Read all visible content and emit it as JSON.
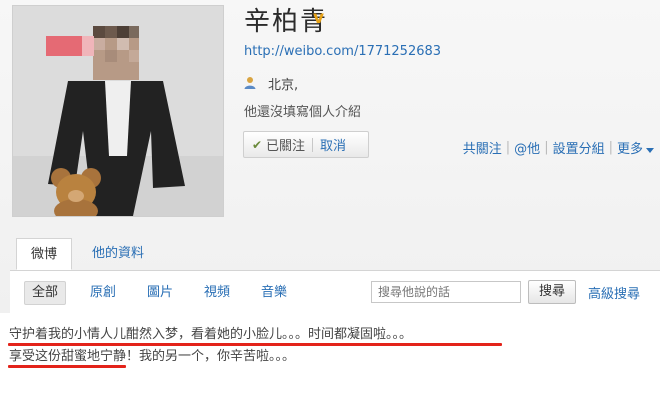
{
  "profile": {
    "name": "辛柏青",
    "verified_badge": "v",
    "url": "http://weibo.com/1771252683",
    "location": "北京,",
    "intro": "他還沒填寫個人介紹"
  },
  "follow": {
    "followed_label": "已關注",
    "cancel_label": "取消"
  },
  "links": {
    "following": "共關注",
    "mention": "@他",
    "set_group": "設置分組",
    "more": "更多"
  },
  "tabs": [
    "微博",
    "他的資料"
  ],
  "filters": [
    "全部",
    "原創",
    "圖片",
    "視頻",
    "音樂"
  ],
  "search": {
    "placeholder": "搜尋他說的話",
    "button": "搜尋",
    "advanced": "高級搜尋"
  },
  "post": {
    "line1": "守护着我的小情人儿酣然入梦，看着她的小脸儿。。。时间都凝固啦。。。",
    "line2": "享受这份甜蜜地宁静！我的另一个，你辛苦啦。。。"
  },
  "colors": {
    "link": "#2a6fb5",
    "highlight_underline": "#e3231a",
    "verified": "#e8a317"
  }
}
